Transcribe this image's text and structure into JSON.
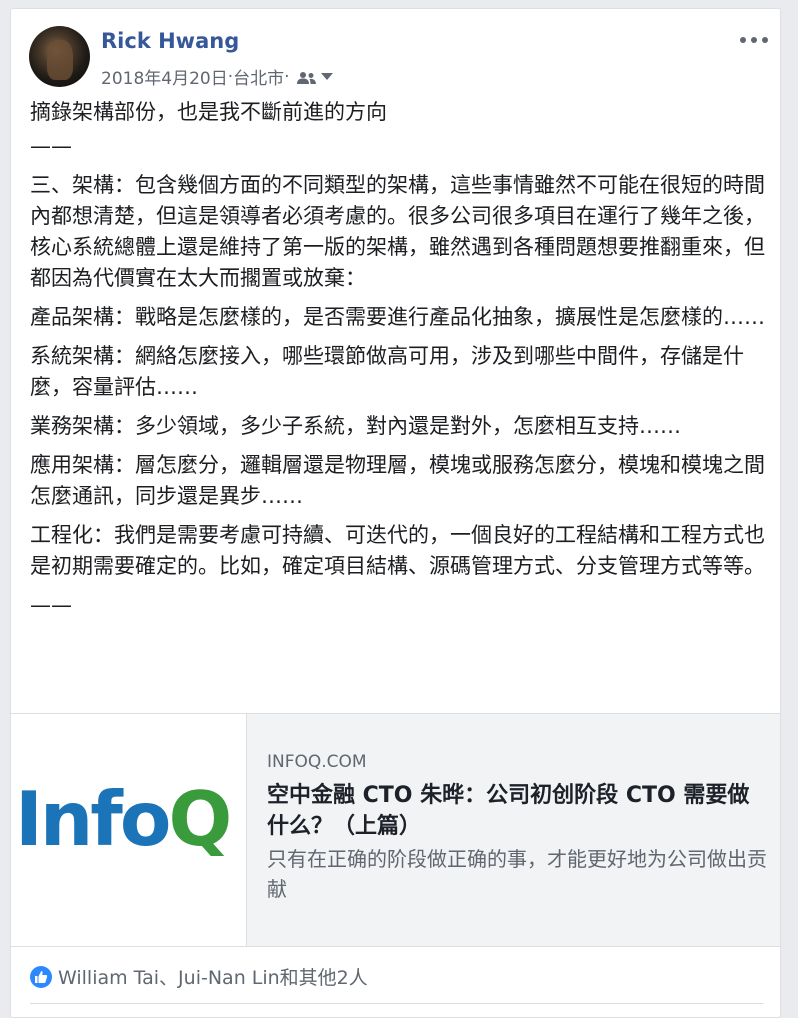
{
  "post": {
    "author": "Rick Hwang",
    "date": "2018年4月20日",
    "separator": " · ",
    "location": "台北市",
    "audience_icon": "friends-icon",
    "more_icon": "more-options-icon"
  },
  "body": {
    "paragraphs": [
      "摘錄架構部份，也是我不斷前進的方向",
      "——",
      "三、架構：包含幾個方面的不同類型的架構，這些事情雖然不可能在很短的時間內都想清楚，但這是領導者必須考慮的。很多公司很多項目在運行了幾年之後，核心系統總體上還是維持了第一版的架構，雖然遇到各種問題想要推翻重來，但都因為代價實在太大而擱置或放棄：",
      "產品架構：戰略是怎麼樣的，是否需要進行產品化抽象，擴展性是怎麼樣的……",
      "系統架構：網絡怎麼接入，哪些環節做高可用，涉及到哪些中間件，存儲是什麼，容量評估……",
      "業務架構：多少領域，多少子系統，對內還是對外，怎麼相互支持……",
      "應用架構：層怎麼分，邏輯層還是物理層，模塊或服務怎麼分，模塊和模塊之間怎麼通訊，同步還是異步……",
      "工程化：我們是需要考慮可持續、可迭代的，一個良好的工程結構和工程方式也是初期需要確定的。比如，確定項目結構、源碼管理方式、分支管理方式等等。",
      "——"
    ]
  },
  "link_preview": {
    "logo_part1": "Info",
    "logo_part2": "Q",
    "domain": "INFOQ.COM",
    "title": "空中金融 CTO 朱晔：公司初创阶段 CTO 需要做什么？（上篇）",
    "description": "只有在正确的阶段做正确的事，才能更好地为公司做出贡献",
    "colors": {
      "logo_blue": "#1b73b8",
      "logo_green": "#3a9b3d"
    }
  },
  "reactions": {
    "icon": "like-icon",
    "text": "William Tai、Jui-Nan Lin和其他2人"
  },
  "colors": {
    "author_link": "#365899",
    "meta_text": "#616770",
    "reaction_blue": "#2d88ff"
  }
}
